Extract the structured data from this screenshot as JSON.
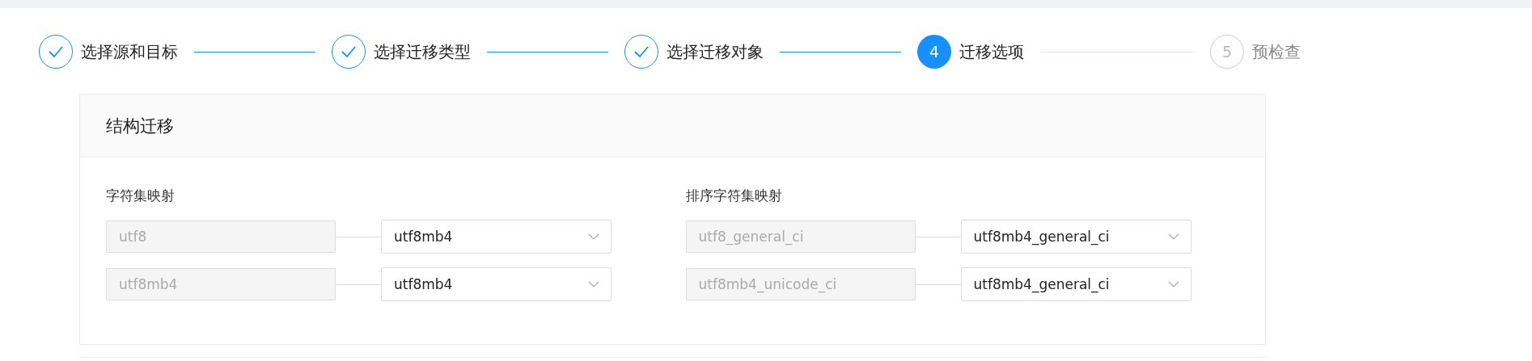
{
  "steps": [
    {
      "label": "选择源和目标",
      "done": true,
      "selected": false
    },
    {
      "label": "选择迁移类型",
      "done": true,
      "selected": false
    },
    {
      "label": "选择迁移对象",
      "done": true,
      "selected": false
    },
    {
      "number": "4",
      "label": "迁移选项",
      "done": false,
      "selected": true
    },
    {
      "number": "5",
      "label": "预检查",
      "done": false,
      "selected": false
    }
  ],
  "panel": {
    "title": "结构迁移",
    "groups": [
      {
        "label": "字符集映射",
        "rows": [
          {
            "source": "utf8",
            "target": "utf8mb4"
          },
          {
            "source": "utf8mb4",
            "target": "utf8mb4"
          }
        ]
      },
      {
        "label": "排序字符集映射",
        "rows": [
          {
            "source": "utf8_general_ci",
            "target": "utf8mb4_general_ci"
          },
          {
            "source": "utf8mb4_unicode_ci",
            "target": "utf8mb4_general_ci"
          }
        ]
      }
    ]
  }
}
